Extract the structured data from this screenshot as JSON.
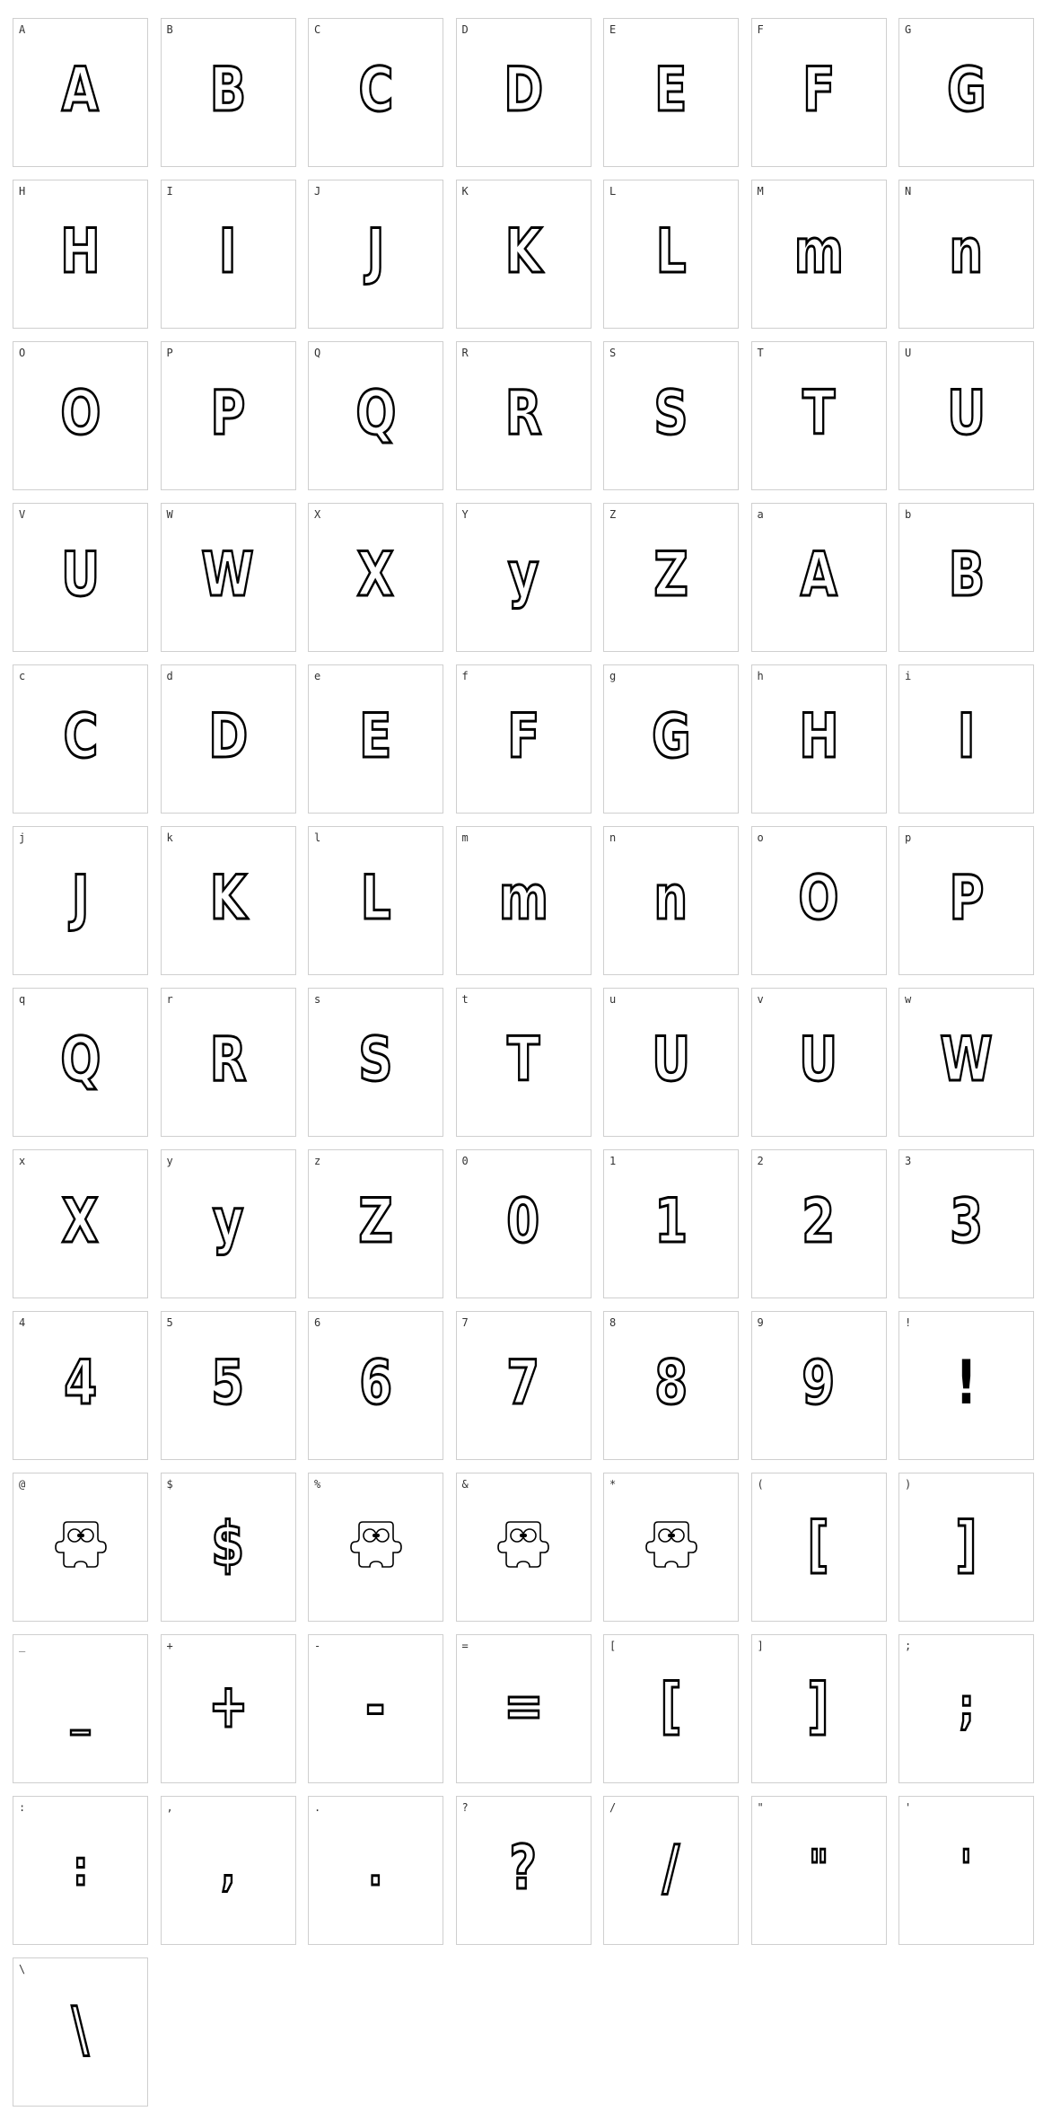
{
  "cells": [
    {
      "label": "A",
      "glyph": "A"
    },
    {
      "label": "B",
      "glyph": "B"
    },
    {
      "label": "C",
      "glyph": "C"
    },
    {
      "label": "D",
      "glyph": "D"
    },
    {
      "label": "E",
      "glyph": "E"
    },
    {
      "label": "F",
      "glyph": "F"
    },
    {
      "label": "G",
      "glyph": "G"
    },
    {
      "label": "H",
      "glyph": "H"
    },
    {
      "label": "I",
      "glyph": "I"
    },
    {
      "label": "J",
      "glyph": "J"
    },
    {
      "label": "K",
      "glyph": "K"
    },
    {
      "label": "L",
      "glyph": "L"
    },
    {
      "label": "M",
      "glyph": "m"
    },
    {
      "label": "N",
      "glyph": "n"
    },
    {
      "label": "O",
      "glyph": "O"
    },
    {
      "label": "P",
      "glyph": "P"
    },
    {
      "label": "Q",
      "glyph": "Q"
    },
    {
      "label": "R",
      "glyph": "R"
    },
    {
      "label": "S",
      "glyph": "S"
    },
    {
      "label": "T",
      "glyph": "T"
    },
    {
      "label": "U",
      "glyph": "U"
    },
    {
      "label": "V",
      "glyph": "U"
    },
    {
      "label": "W",
      "glyph": "W"
    },
    {
      "label": "X",
      "glyph": "X"
    },
    {
      "label": "Y",
      "glyph": "y"
    },
    {
      "label": "Z",
      "glyph": "Z"
    },
    {
      "label": "a",
      "glyph": "A"
    },
    {
      "label": "b",
      "glyph": "B"
    },
    {
      "label": "c",
      "glyph": "C"
    },
    {
      "label": "d",
      "glyph": "D"
    },
    {
      "label": "e",
      "glyph": "E"
    },
    {
      "label": "f",
      "glyph": "F"
    },
    {
      "label": "g",
      "glyph": "G"
    },
    {
      "label": "h",
      "glyph": "H"
    },
    {
      "label": "i",
      "glyph": "I"
    },
    {
      "label": "j",
      "glyph": "J"
    },
    {
      "label": "k",
      "glyph": "K"
    },
    {
      "label": "l",
      "glyph": "L"
    },
    {
      "label": "m",
      "glyph": "m"
    },
    {
      "label": "n",
      "glyph": "n"
    },
    {
      "label": "o",
      "glyph": "O"
    },
    {
      "label": "p",
      "glyph": "P"
    },
    {
      "label": "q",
      "glyph": "Q"
    },
    {
      "label": "r",
      "glyph": "R"
    },
    {
      "label": "s",
      "glyph": "S"
    },
    {
      "label": "t",
      "glyph": "T"
    },
    {
      "label": "u",
      "glyph": "U"
    },
    {
      "label": "v",
      "glyph": "U"
    },
    {
      "label": "w",
      "glyph": "W"
    },
    {
      "label": "x",
      "glyph": "X"
    },
    {
      "label": "y",
      "glyph": "y"
    },
    {
      "label": "z",
      "glyph": "Z"
    },
    {
      "label": "0",
      "glyph": "0"
    },
    {
      "label": "1",
      "glyph": "1"
    },
    {
      "label": "2",
      "glyph": "2"
    },
    {
      "label": "3",
      "glyph": "3"
    },
    {
      "label": "4",
      "glyph": "4"
    },
    {
      "label": "5",
      "glyph": "5"
    },
    {
      "label": "6",
      "glyph": "6"
    },
    {
      "label": "7",
      "glyph": "7"
    },
    {
      "label": "8",
      "glyph": "8"
    },
    {
      "label": "9",
      "glyph": "9"
    },
    {
      "label": "!",
      "glyph": "!",
      "style": "solid"
    },
    {
      "label": "@",
      "icon": "monster-icon"
    },
    {
      "label": "$",
      "glyph": "$"
    },
    {
      "label": "%",
      "icon": "monster-icon"
    },
    {
      "label": "&",
      "icon": "monster-icon"
    },
    {
      "label": "*",
      "icon": "monster-icon"
    },
    {
      "label": "(",
      "glyph": "["
    },
    {
      "label": ")",
      "glyph": "]"
    },
    {
      "label": "_",
      "glyph": "_",
      "style": "small"
    },
    {
      "label": "+",
      "glyph": "+"
    },
    {
      "label": "-",
      "glyph": "-"
    },
    {
      "label": "=",
      "glyph": "="
    },
    {
      "label": "[",
      "glyph": "["
    },
    {
      "label": "]",
      "glyph": "]"
    },
    {
      "label": ";",
      "glyph": ";",
      "style": "small"
    },
    {
      "label": ":",
      "glyph": ":",
      "style": "small"
    },
    {
      "label": ",",
      "glyph": ",",
      "style": "small"
    },
    {
      "label": ".",
      "glyph": ".",
      "style": "small"
    },
    {
      "label": "?",
      "glyph": "?"
    },
    {
      "label": "/",
      "glyph": "/"
    },
    {
      "label": "\"",
      "glyph": "\"",
      "style": "small"
    },
    {
      "label": "'",
      "glyph": "'",
      "style": "small"
    },
    {
      "label": "\\",
      "glyph": "\\"
    }
  ]
}
